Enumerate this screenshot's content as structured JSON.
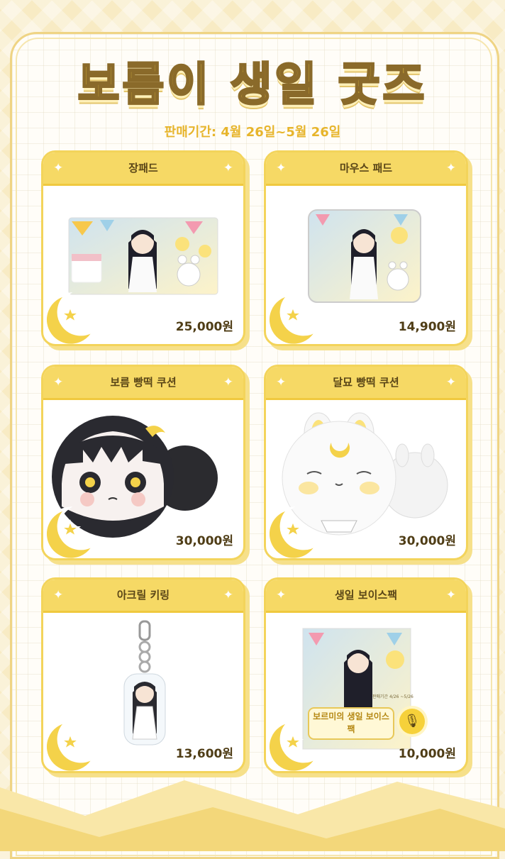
{
  "title": "보름이 생일 굿즈",
  "period": "판매기간: 4월 26일~5월 26일",
  "products": [
    {
      "name": "장패드",
      "price": "25,000원"
    },
    {
      "name": "마우스 패드",
      "price": "14,900원"
    },
    {
      "name": "보름 빵떡 쿠션",
      "price": "30,000원"
    },
    {
      "name": "달묘 빵떡 쿠션",
      "price": "30,000원"
    },
    {
      "name": "아크릴 키링",
      "price": "13,600원"
    },
    {
      "name": "생일 보이스팩",
      "price": "10,000원"
    }
  ],
  "voicepack": {
    "badge": "보르미의 생일 보이스팩",
    "dates": "판매기간 4/26 ~5/26"
  },
  "colors": {
    "accent": "#f6d965",
    "title": "#f5cf3f",
    "moon": "#f4d24a"
  },
  "icons": [
    "sparkle-icon",
    "crescent-moon-icon",
    "star-icon",
    "microphone-icon"
  ]
}
